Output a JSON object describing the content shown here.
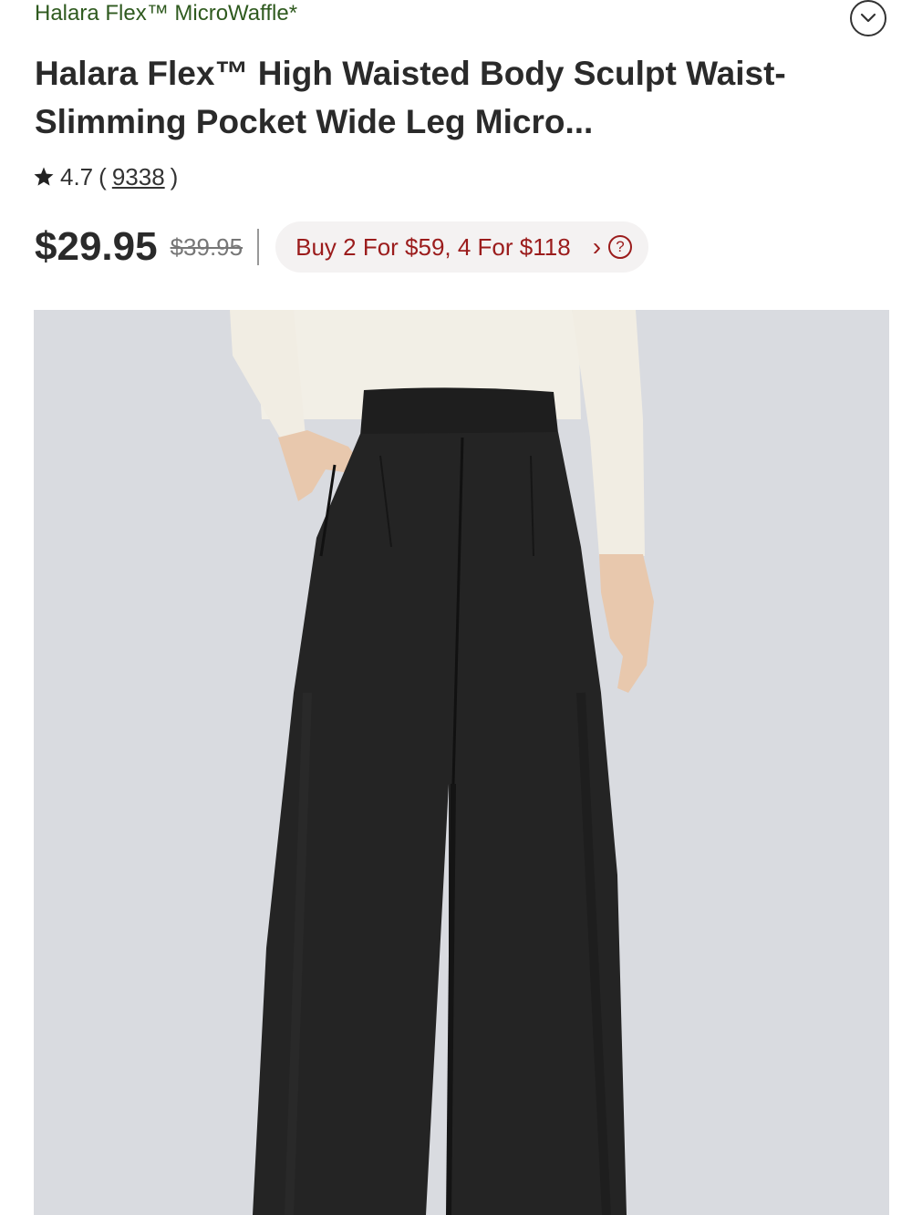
{
  "collection_link": "Halara Flex™ MicroWaffle*",
  "product": {
    "title": "Halara Flex™ High Waisted Body Sculpt Waist-Slimming Pocket Wide Leg Micro...",
    "rating": "4.7",
    "review_count": "9338",
    "price": "$29.95",
    "original_price": "$39.95"
  },
  "promo": {
    "label": "Buy 2 For $59, 4 For $118",
    "help_glyph": "?"
  },
  "icons": {
    "star": "star-icon",
    "collapse": "chevron-down-circle-icon",
    "promo_arrow": "chevron-right-icon",
    "help": "question-circle-icon"
  },
  "colors": {
    "collection_link": "#2f5a1f",
    "promo_text": "#9b1c1c",
    "promo_bg": "#f4f2f2",
    "image_bg": "#d9dbe0"
  }
}
